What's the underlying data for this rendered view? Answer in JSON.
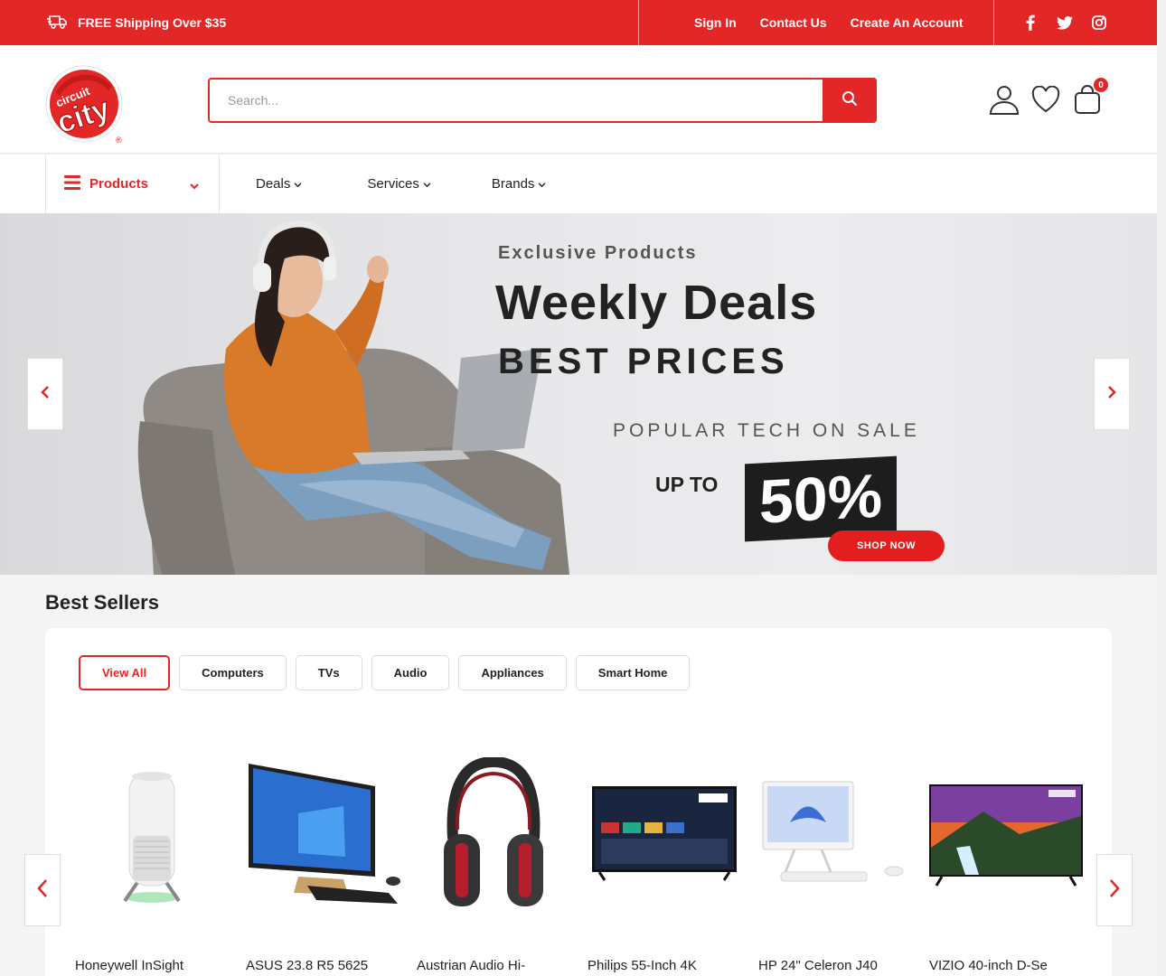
{
  "topbar": {
    "shipping": "FREE Shipping Over $35",
    "links": [
      "Sign In",
      "Contact Us",
      "Create An Account"
    ]
  },
  "brand": {
    "logo_top": "circuit",
    "logo_main": "city"
  },
  "search": {
    "placeholder": "Search..."
  },
  "cart": {
    "count": "0"
  },
  "nav": {
    "products": "Products",
    "items": [
      "Deals",
      "Services",
      "Brands"
    ]
  },
  "hero": {
    "eyebrow": "Exclusive Products",
    "headline": "Weekly Deals",
    "sub": "BEST PRICES",
    "popular": "POPULAR TECH ON SALE",
    "upto": "UP TO",
    "percent": "50%",
    "cta": "SHOP NOW"
  },
  "best_sellers": {
    "title": "Best Sellers",
    "tabs": [
      "View All",
      "Computers",
      "TVs",
      "Audio",
      "Appliances",
      "Smart Home"
    ],
    "products": [
      "Honeywell InSight",
      "ASUS 23.8 R5 5625",
      "Austrian Audio Hi-",
      "Philips 55-Inch 4K",
      "HP 24\" Celeron J40",
      "VIZIO 40-inch D-Se"
    ]
  },
  "colors": {
    "brand_red": "#e32726",
    "dark": "#222222"
  }
}
